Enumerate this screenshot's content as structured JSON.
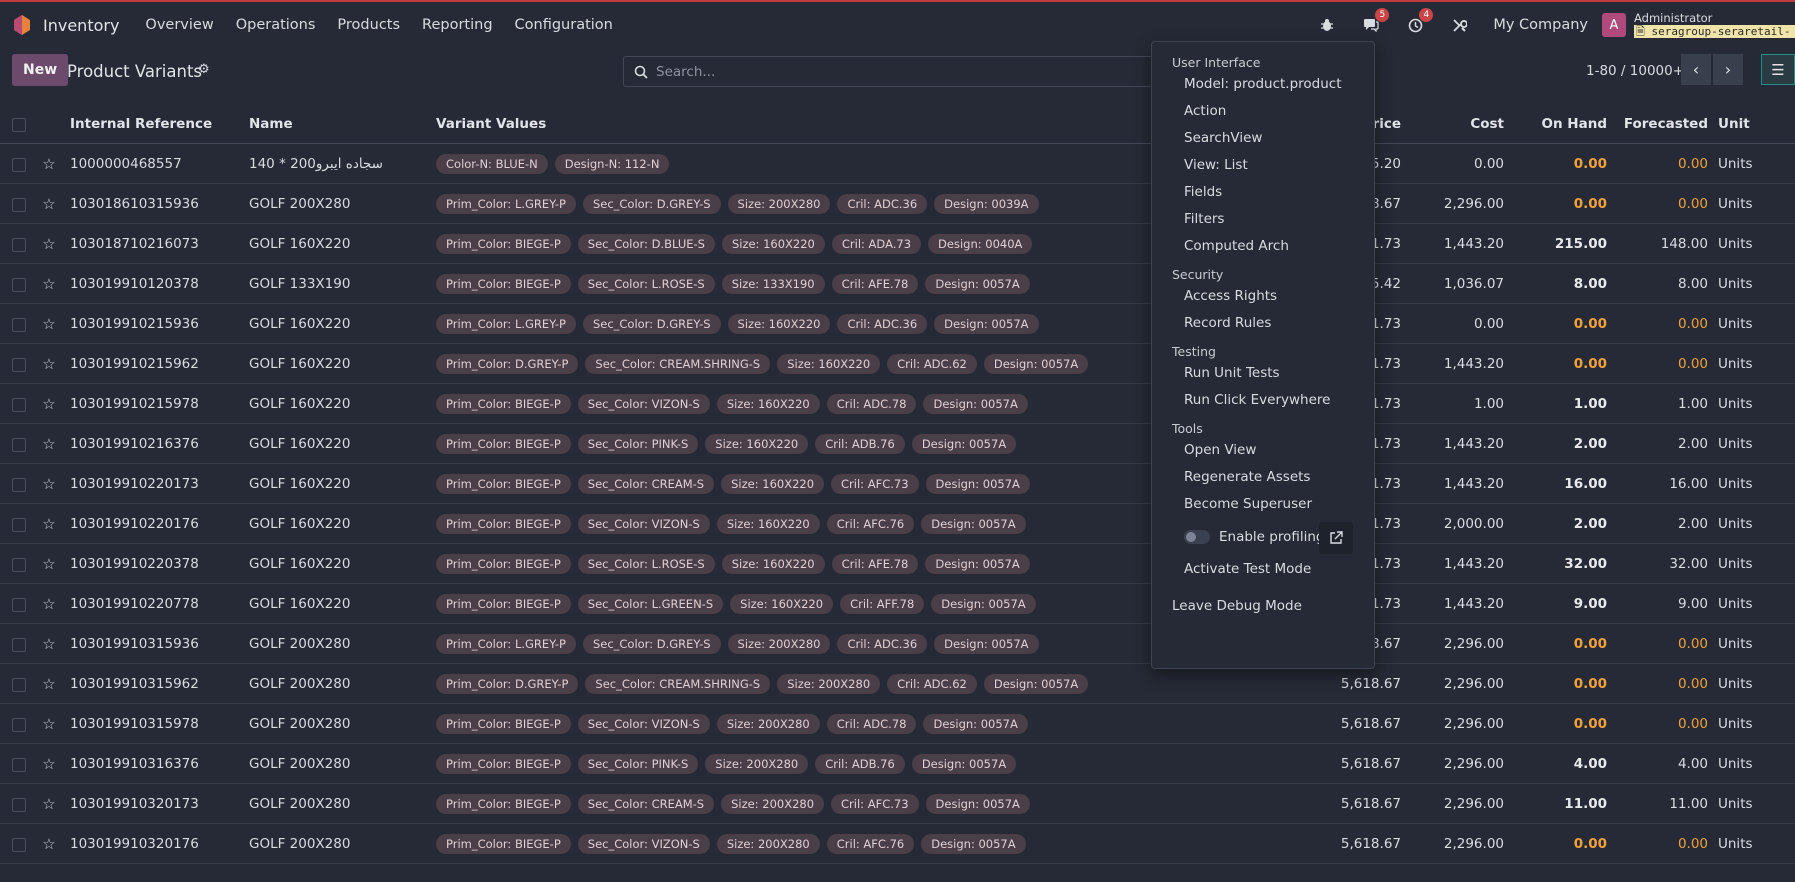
{
  "navbar": {
    "app_name": "Inventory",
    "menu": [
      "Overview",
      "Operations",
      "Products",
      "Reporting",
      "Configuration"
    ],
    "messages_badge": "5",
    "activity_badge": "4",
    "company": "My Company",
    "avatar_letter": "A",
    "user_name": "Administrator",
    "database": "seragroup-seraretail-"
  },
  "control": {
    "new_label": "New",
    "title": "Product Variants",
    "search_placeholder": "Search...",
    "pager": "1-80 / 10000+"
  },
  "table": {
    "headers": {
      "ref": "Internal Reference",
      "name": "Name",
      "variants": "Variant Values",
      "price": "Price",
      "cost": "Cost",
      "on_hand": "On Hand",
      "forecasted": "Forecasted",
      "unit": "Unit"
    },
    "rows": [
      {
        "ref": "1000000468557",
        "name": "سجاده ايبرو200 * 140",
        "tags": [
          "Color-N: BLUE-N",
          "Design-N: 112-N"
        ],
        "price": "5.20",
        "cost": "0.00",
        "on_hand": "0.00",
        "forecasted": "0.00",
        "unit": "Units"
      },
      {
        "ref": "103018610315936",
        "name": "GOLF 200X280",
        "tags": [
          "Prim_Color: L.GREY-P",
          "Sec_Color: D.GREY-S",
          "Size: 200X280",
          "Cril: ADC.36",
          "Design: 0039A"
        ],
        "price": "8.67",
        "cost": "2,296.00",
        "on_hand": "0.00",
        "forecasted": "0.00",
        "unit": "Units"
      },
      {
        "ref": "103018710216073",
        "name": "GOLF 160X220",
        "tags": [
          "Prim_Color: BIEGE-P",
          "Sec_Color: D.BLUE-S",
          "Size: 160X220",
          "Cril: ADA.73",
          "Design: 0040A"
        ],
        "price": "1.73",
        "cost": "1,443.20",
        "on_hand": "215.00",
        "forecasted": "148.00",
        "unit": "Units"
      },
      {
        "ref": "103019910120378",
        "name": "GOLF 133X190",
        "tags": [
          "Prim_Color: BIEGE-P",
          "Sec_Color: L.ROSE-S",
          "Size: 133X190",
          "Cril: AFE.78",
          "Design: 0057A"
        ],
        "price": "5.42",
        "cost": "1,036.07",
        "on_hand": "8.00",
        "forecasted": "8.00",
        "unit": "Units"
      },
      {
        "ref": "103019910215936",
        "name": "GOLF 160X220",
        "tags": [
          "Prim_Color: L.GREY-P",
          "Sec_Color: D.GREY-S",
          "Size: 160X220",
          "Cril: ADC.36",
          "Design: 0057A"
        ],
        "price": "1.73",
        "cost": "0.00",
        "on_hand": "0.00",
        "forecasted": "0.00",
        "unit": "Units"
      },
      {
        "ref": "103019910215962",
        "name": "GOLF 160X220",
        "tags": [
          "Prim_Color: D.GREY-P",
          "Sec_Color: CREAM.SHRING-S",
          "Size: 160X220",
          "Cril: ADC.62",
          "Design: 0057A"
        ],
        "price": "1.73",
        "cost": "1,443.20",
        "on_hand": "0.00",
        "forecasted": "0.00",
        "unit": "Units"
      },
      {
        "ref": "103019910215978",
        "name": "GOLF 160X220",
        "tags": [
          "Prim_Color: BIEGE-P",
          "Sec_Color: VIZON-S",
          "Size: 160X220",
          "Cril: ADC.78",
          "Design: 0057A"
        ],
        "price": "1.73",
        "cost": "1.00",
        "on_hand": "1.00",
        "forecasted": "1.00",
        "unit": "Units"
      },
      {
        "ref": "103019910216376",
        "name": "GOLF 160X220",
        "tags": [
          "Prim_Color: BIEGE-P",
          "Sec_Color: PINK-S",
          "Size: 160X220",
          "Cril: ADB.76",
          "Design: 0057A"
        ],
        "price": "1.73",
        "cost": "1,443.20",
        "on_hand": "2.00",
        "forecasted": "2.00",
        "unit": "Units"
      },
      {
        "ref": "103019910220173",
        "name": "GOLF 160X220",
        "tags": [
          "Prim_Color: BIEGE-P",
          "Sec_Color: CREAM-S",
          "Size: 160X220",
          "Cril: AFC.73",
          "Design: 0057A"
        ],
        "price": "1.73",
        "cost": "1,443.20",
        "on_hand": "16.00",
        "forecasted": "16.00",
        "unit": "Units"
      },
      {
        "ref": "103019910220176",
        "name": "GOLF 160X220",
        "tags": [
          "Prim_Color: BIEGE-P",
          "Sec_Color: VIZON-S",
          "Size: 160X220",
          "Cril: AFC.76",
          "Design: 0057A"
        ],
        "price": "1.73",
        "cost": "2,000.00",
        "on_hand": "2.00",
        "forecasted": "2.00",
        "unit": "Units"
      },
      {
        "ref": "103019910220378",
        "name": "GOLF 160X220",
        "tags": [
          "Prim_Color: BIEGE-P",
          "Sec_Color: L.ROSE-S",
          "Size: 160X220",
          "Cril: AFE.78",
          "Design: 0057A"
        ],
        "price": "1.73",
        "cost": "1,443.20",
        "on_hand": "32.00",
        "forecasted": "32.00",
        "unit": "Units"
      },
      {
        "ref": "103019910220778",
        "name": "GOLF 160X220",
        "tags": [
          "Prim_Color: BIEGE-P",
          "Sec_Color: L.GREEN-S",
          "Size: 160X220",
          "Cril: AFF.78",
          "Design: 0057A"
        ],
        "price": "1.73",
        "cost": "1,443.20",
        "on_hand": "9.00",
        "forecasted": "9.00",
        "unit": "Units"
      },
      {
        "ref": "103019910315936",
        "name": "GOLF 200X280",
        "tags": [
          "Prim_Color: L.GREY-P",
          "Sec_Color: D.GREY-S",
          "Size: 200X280",
          "Cril: ADC.36",
          "Design: 0057A"
        ],
        "price": "8.67",
        "cost": "2,296.00",
        "on_hand": "0.00",
        "forecasted": "0.00",
        "unit": "Units"
      },
      {
        "ref": "103019910315962",
        "name": "GOLF 200X280",
        "tags": [
          "Prim_Color: D.GREY-P",
          "Sec_Color: CREAM.SHRING-S",
          "Size: 200X280",
          "Cril: ADC.62",
          "Design: 0057A"
        ],
        "price": "5,618.67",
        "cost": "2,296.00",
        "on_hand": "0.00",
        "forecasted": "0.00",
        "unit": "Units"
      },
      {
        "ref": "103019910315978",
        "name": "GOLF 200X280",
        "tags": [
          "Prim_Color: BIEGE-P",
          "Sec_Color: VIZON-S",
          "Size: 200X280",
          "Cril: ADC.78",
          "Design: 0057A"
        ],
        "price": "5,618.67",
        "cost": "2,296.00",
        "on_hand": "0.00",
        "forecasted": "0.00",
        "unit": "Units"
      },
      {
        "ref": "103019910316376",
        "name": "GOLF 200X280",
        "tags": [
          "Prim_Color: BIEGE-P",
          "Sec_Color: PINK-S",
          "Size: 200X280",
          "Cril: ADB.76",
          "Design: 0057A"
        ],
        "price": "5,618.67",
        "cost": "2,296.00",
        "on_hand": "4.00",
        "forecasted": "4.00",
        "unit": "Units"
      },
      {
        "ref": "103019910320173",
        "name": "GOLF 200X280",
        "tags": [
          "Prim_Color: BIEGE-P",
          "Sec_Color: CREAM-S",
          "Size: 200X280",
          "Cril: AFC.73",
          "Design: 0057A"
        ],
        "price": "5,618.67",
        "cost": "2,296.00",
        "on_hand": "11.00",
        "forecasted": "11.00",
        "unit": "Units"
      },
      {
        "ref": "103019910320176",
        "name": "GOLF 200X280",
        "tags": [
          "Prim_Color: BIEGE-P",
          "Sec_Color: VIZON-S",
          "Size: 200X280",
          "Cril: AFC.76",
          "Design: 0057A"
        ],
        "price": "5,618.67",
        "cost": "2,296.00",
        "on_hand": "0.00",
        "forecasted": "0.00",
        "unit": "Units"
      }
    ]
  },
  "debug_menu": {
    "sections": [
      {
        "header": "User Interface",
        "items": [
          "Model: product.product",
          "Action",
          "SearchView",
          "View: List",
          "Fields",
          "Filters",
          "Computed Arch"
        ]
      },
      {
        "header": "Security",
        "items": [
          "Access Rights",
          "Record Rules"
        ]
      },
      {
        "header": "Testing",
        "items": [
          "Run Unit Tests",
          "Run Click Everywhere"
        ]
      },
      {
        "header": "Tools",
        "items": [
          "Open View",
          "Regenerate Assets",
          "Become Superuser"
        ]
      }
    ],
    "profiling_label": "Enable profiling",
    "test_mode_label": "Activate Test Mode",
    "leave_label": "Leave Debug Mode"
  },
  "colors": {
    "background": "#262a36",
    "accent": "#6b4a6c",
    "zero_value": "#f0a13a",
    "badge": "#c94547",
    "tag": "#4a3e48"
  }
}
